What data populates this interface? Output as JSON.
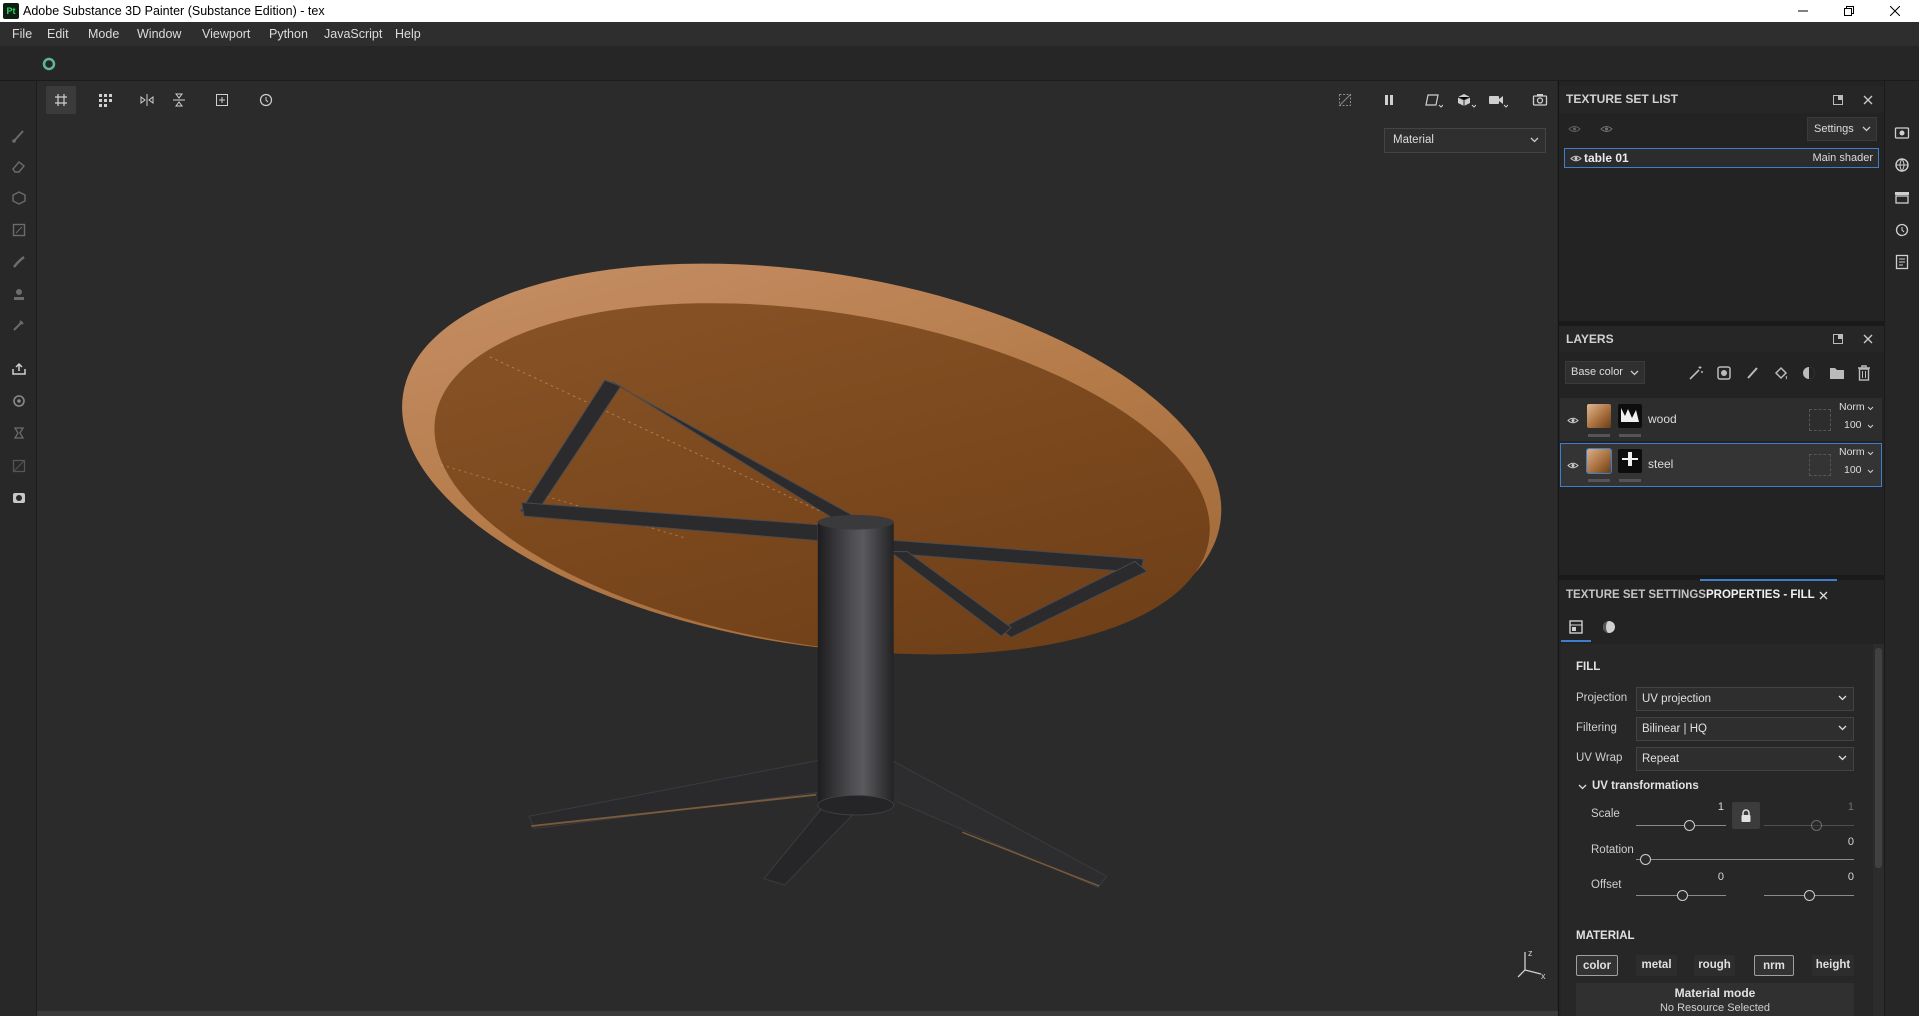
{
  "window": {
    "app_icon": "Pt",
    "title": "Adobe Substance 3D Painter (Substance Edition) - tex"
  },
  "menu": [
    "File",
    "Edit",
    "Mode",
    "Window",
    "Viewport",
    "Python",
    "JavaScript",
    "Help"
  ],
  "viewport": {
    "display_mode": "Material",
    "axis_labels": {
      "z": "z",
      "x": "x"
    }
  },
  "texture_set_list": {
    "title": "TEXTURE SET LIST",
    "settings": "Settings",
    "items": [
      {
        "name": "table 01",
        "shader": "Main shader"
      }
    ]
  },
  "layers": {
    "title": "LAYERS",
    "channel": "Base color",
    "selected": "steel",
    "items": [
      {
        "name": "wood",
        "blend": "Norm",
        "opacity": "100"
      },
      {
        "name": "steel",
        "blend": "Norm",
        "opacity": "100"
      }
    ]
  },
  "properties": {
    "tabs": [
      "TEXTURE SET SETTINGS",
      "PROPERTIES - FILL"
    ],
    "active_tab": "PROPERTIES - FILL",
    "fill": {
      "title": "FILL",
      "projection": {
        "label": "Projection",
        "value": "UV projection"
      },
      "filtering": {
        "label": "Filtering",
        "value": "Bilinear | HQ"
      },
      "uv_wrap": {
        "label": "UV Wrap",
        "value": "Repeat"
      }
    },
    "uv_transformations": {
      "title": "UV transformations",
      "scale": {
        "label": "Scale",
        "u": "1",
        "v": "1",
        "locked": true
      },
      "rotation": {
        "label": "Rotation",
        "value": "0"
      },
      "offset": {
        "label": "Offset",
        "u": "0",
        "v": "0"
      }
    },
    "material": {
      "title": "MATERIAL",
      "channels": [
        "color",
        "metal",
        "rough",
        "nrm",
        "height"
      ],
      "active_channels": [
        "color",
        "nrm"
      ],
      "mode_title": "Material mode",
      "mode_value": "No Resource Selected"
    }
  },
  "colors": {
    "accent": "#3d7ecf",
    "panel": "#232323",
    "viewport": "#2b2b2b",
    "wood": "#a8713f",
    "steel": "#2c2c2e"
  }
}
